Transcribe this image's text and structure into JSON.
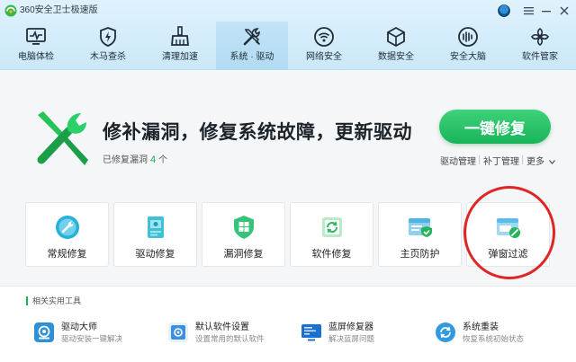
{
  "app": {
    "title": "360安全卫士极速版"
  },
  "nav": {
    "items": [
      {
        "label": "电脑体检",
        "icon": "monitor-icon",
        "active": false
      },
      {
        "label": "木马查杀",
        "icon": "shield-bolt-icon",
        "active": false
      },
      {
        "label": "清理加速",
        "icon": "broom-icon",
        "active": false
      },
      {
        "label": "系统 · 驱动",
        "icon": "wrench-screwdriver-icon",
        "active": true
      },
      {
        "label": "网络安全",
        "icon": "wifi-icon",
        "active": false
      },
      {
        "label": "数据安全",
        "icon": "cube-icon",
        "active": false
      },
      {
        "label": "安全大脑",
        "icon": "brain-icon",
        "active": false
      },
      {
        "label": "软件管家",
        "icon": "software-grid-icon",
        "active": false
      }
    ]
  },
  "hero": {
    "title": "修补漏洞，修复系统故障，更新驱动",
    "sub_prefix": "已修复漏洞",
    "sub_count": "4",
    "sub_suffix": "个",
    "fix_button": "一键修复",
    "links": [
      "驱动管理",
      "补丁管理",
      "更多"
    ]
  },
  "cards": [
    {
      "label": "常规修复",
      "icon": "wrench-badge-icon"
    },
    {
      "label": "驱动修复",
      "icon": "driver-chip-icon"
    },
    {
      "label": "漏洞修复",
      "icon": "windows-shield-icon"
    },
    {
      "label": "软件修复",
      "icon": "software-refresh-icon"
    },
    {
      "label": "主页防护",
      "icon": "homepage-shield-icon"
    },
    {
      "label": "弹窗过滤",
      "icon": "popup-block-icon"
    }
  ],
  "utilities": {
    "section_title": "相关实用工具",
    "items": [
      {
        "name": "驱动大师",
        "desc": "驱动安装一键解决",
        "icon": "driver-master-icon",
        "color": "#2d8fd6"
      },
      {
        "name": "默认软件设置",
        "desc": "设置常用的默认软件",
        "icon": "default-software-icon",
        "color": "#3d8fe0"
      },
      {
        "name": "蓝屏修复器",
        "desc": "解决蓝屏问题",
        "icon": "bluescreen-repair-icon",
        "color": "#1a6fd1"
      },
      {
        "name": "系统重装",
        "desc": "恢复系统初始状态",
        "icon": "system-reinstall-icon",
        "color": "#2f9ae0"
      }
    ]
  },
  "colors": {
    "accent_green": "#19b45a",
    "header_blue": "#cbe8f8",
    "highlight_red": "#e02525"
  }
}
